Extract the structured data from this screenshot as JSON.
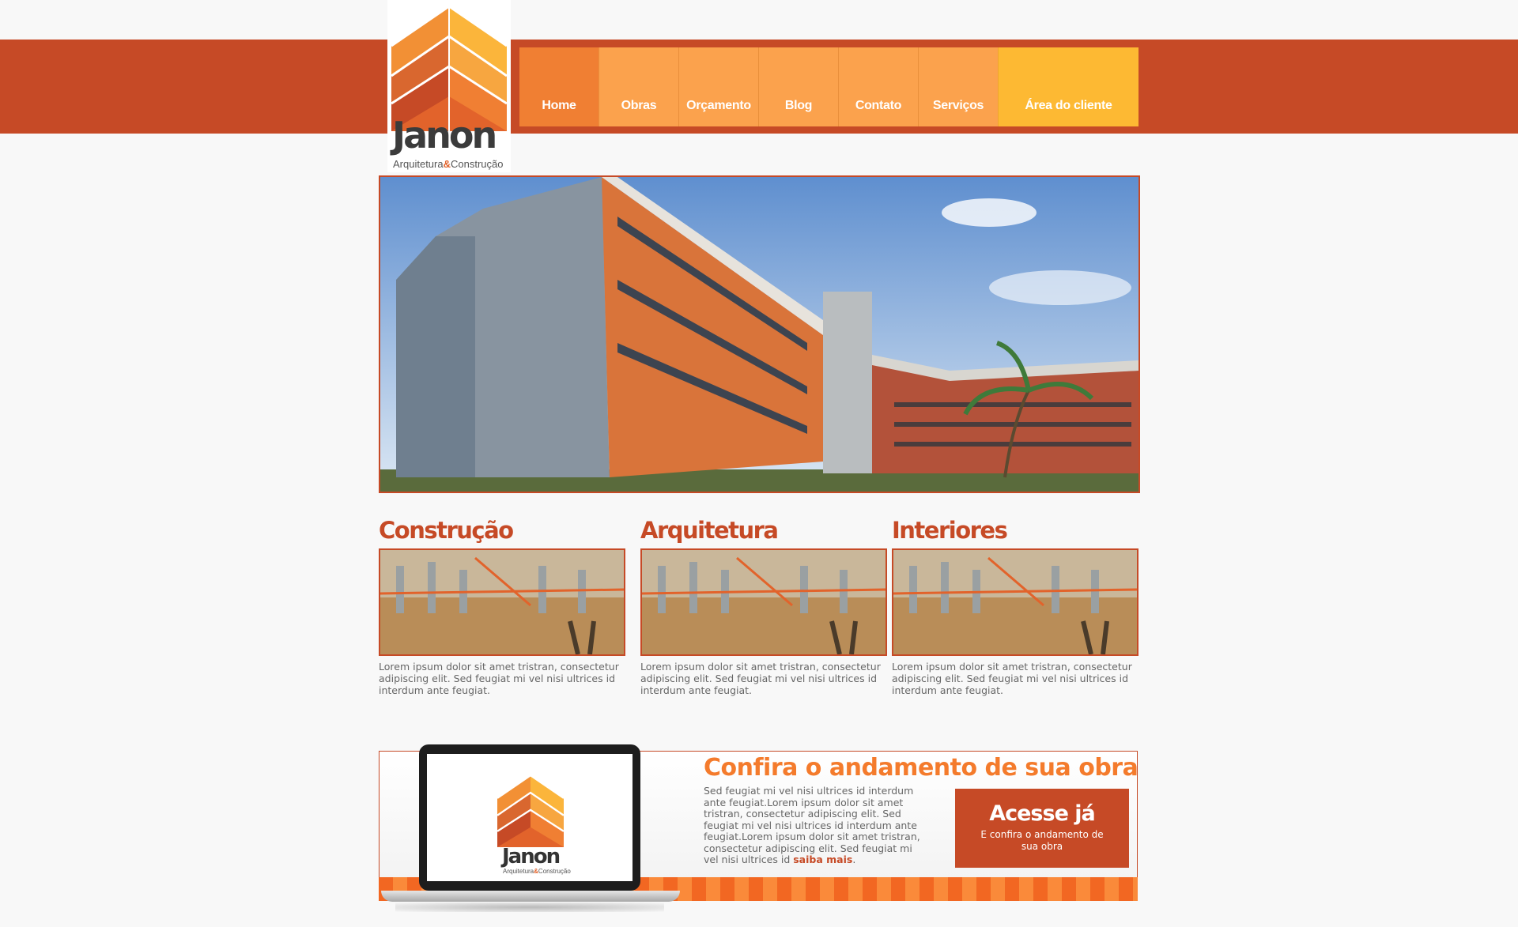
{
  "brand": {
    "name": "Janon",
    "tagline_part1": "Arquitetura",
    "tagline_amp": "&",
    "tagline_part2": "Construção",
    "primary_color": "#c64a26",
    "orange": "#f47b2c",
    "yellow": "#fdb933"
  },
  "nav": {
    "items": [
      {
        "label": "Home"
      },
      {
        "label": "Obras"
      },
      {
        "label": "Orçamento"
      },
      {
        "label": "Blog"
      },
      {
        "label": "Contato"
      },
      {
        "label": "Serviços"
      }
    ],
    "client_area": "Área do cliente"
  },
  "hero": {
    "icon": "building-photo"
  },
  "columns": [
    {
      "title": "Construção",
      "text": "Lorem ipsum dolor sit amet tristran, consectetur adipiscing elit. Sed feugiat mi vel nisi ultrices id interdum ante feugiat."
    },
    {
      "title": "Arquitetura",
      "text": "Lorem ipsum dolor sit amet tristran, consectetur adipiscing elit. Sed feugiat mi vel nisi ultrices id interdum ante feugiat."
    },
    {
      "title": "Interiores",
      "text": "Lorem ipsum dolor sit amet tristran, consectetur adipiscing elit. Sed feugiat mi vel nisi ultrices id interdum ante feugiat."
    }
  ],
  "cta": {
    "title": "Confira o andamento de sua obra",
    "text": "Sed feugiat mi vel nisi ultrices id interdum ante feugiat.Lorem ipsum dolor sit amet tristran, consectetur adipiscing elit. Sed feugiat mi vel nisi ultrices id interdum ante feugiat.Lorem ipsum dolor sit amet tristran, consectetur adipiscing elit. Sed feugiat mi vel nisi ultrices id ",
    "more_link": "saiba mais",
    "after_link": ".",
    "button_title": "Acesse já",
    "button_sub": "E confira o andamento de sua obra"
  }
}
